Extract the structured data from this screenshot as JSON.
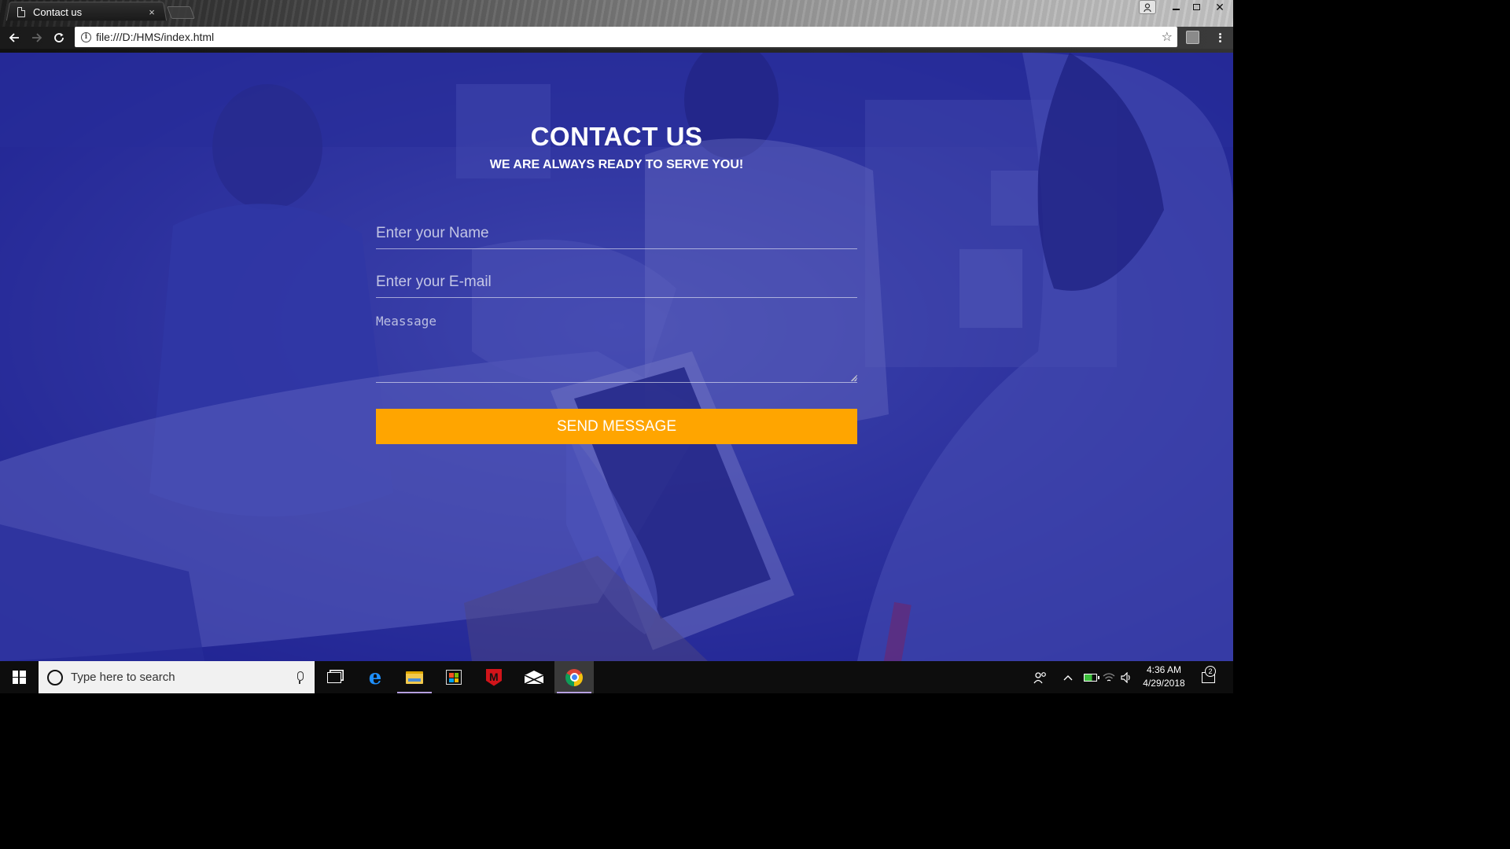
{
  "browser": {
    "tab_title": "Contact us",
    "tab_close": "×",
    "url": "file:///D:/HMS/index.html",
    "window_controls": {
      "close": "✕"
    }
  },
  "contact": {
    "title": "CONTACT US",
    "subtitle": "WE ARE ALWAYS READY TO SERVE YOU!",
    "name_placeholder": "Enter your Name",
    "email_placeholder": "Enter your E-mail",
    "message_placeholder": "Meassage",
    "send_button": "SEND MESSAGE"
  },
  "colors": {
    "overlay": "#181a96",
    "button": "#ffa500"
  },
  "taskbar": {
    "search_placeholder": "Type here to search",
    "time": "4:36 AM",
    "date": "4/29/2018",
    "notification_count": "2",
    "apps": [
      "task-view",
      "edge",
      "file-explorer",
      "store",
      "mcafee",
      "mail",
      "chrome"
    ]
  }
}
